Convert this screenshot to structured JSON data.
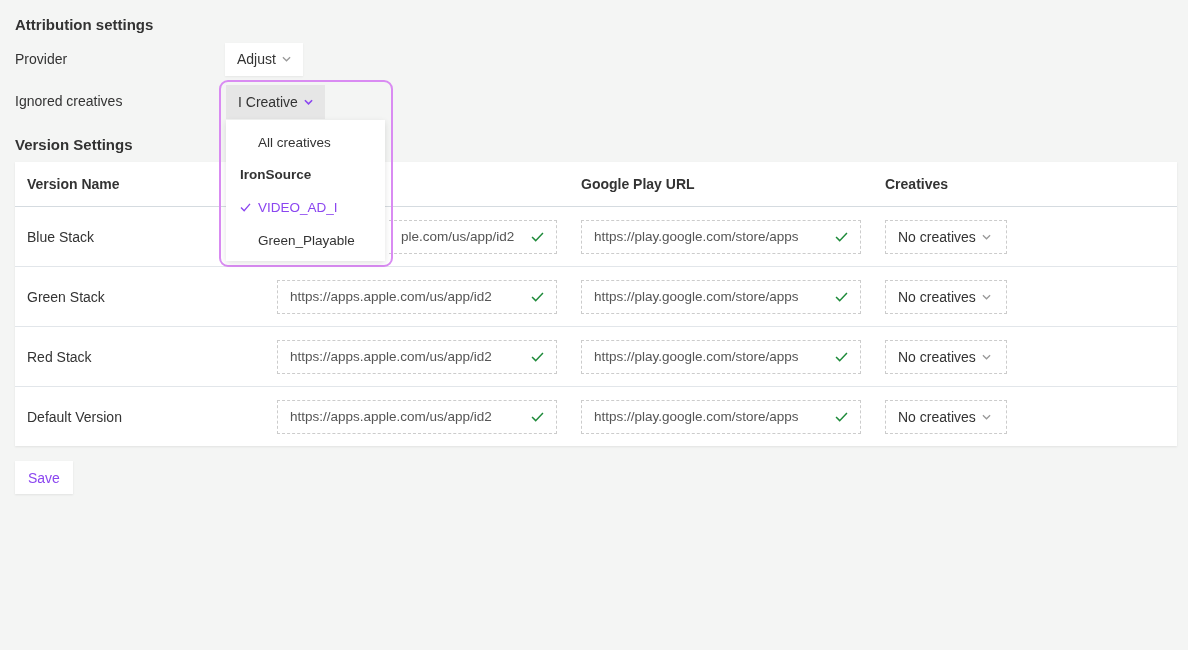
{
  "attribution": {
    "title": "Attribution settings",
    "provider": {
      "label": "Provider",
      "value": "Adjust"
    },
    "ignored_creatives": {
      "label": "Ignored creatives",
      "value": "I Creative",
      "expanded": true,
      "options": [
        {
          "kind": "option",
          "label": "All creatives",
          "selected": false
        },
        {
          "kind": "group",
          "label": "IronSource"
        },
        {
          "kind": "option",
          "label": "VIDEO_AD_I",
          "selected": true
        },
        {
          "kind": "option",
          "label": "Green_Playable",
          "selected": false
        }
      ]
    }
  },
  "versions": {
    "title": "Version Settings",
    "columns": [
      "Version Name",
      "Google Play URL",
      "Creatives"
    ],
    "rows": [
      {
        "name": "Blue Stack",
        "ios_url": "ple.com/us/app/id2",
        "ios_valid": true,
        "play_url": "https://play.google.com/store/apps",
        "play_valid": true,
        "creatives": "No creatives",
        "partly_covered": true
      },
      {
        "name": "Green Stack",
        "ios_url": "https://apps.apple.com/us/app/id2",
        "ios_valid": true,
        "play_url": "https://play.google.com/store/apps",
        "play_valid": true,
        "creatives": "No creatives",
        "partly_covered": false
      },
      {
        "name": "Red Stack",
        "ios_url": "https://apps.apple.com/us/app/id2",
        "ios_valid": true,
        "play_url": "https://play.google.com/store/apps",
        "play_valid": true,
        "creatives": "No creatives",
        "partly_covered": false
      },
      {
        "name": "Default Version",
        "ios_url": "https://apps.apple.com/us/app/id2",
        "ios_valid": true,
        "play_url": "https://play.google.com/store/apps",
        "play_valid": true,
        "creatives": "No creatives",
        "partly_covered": false
      }
    ]
  },
  "save_button": "Save"
}
